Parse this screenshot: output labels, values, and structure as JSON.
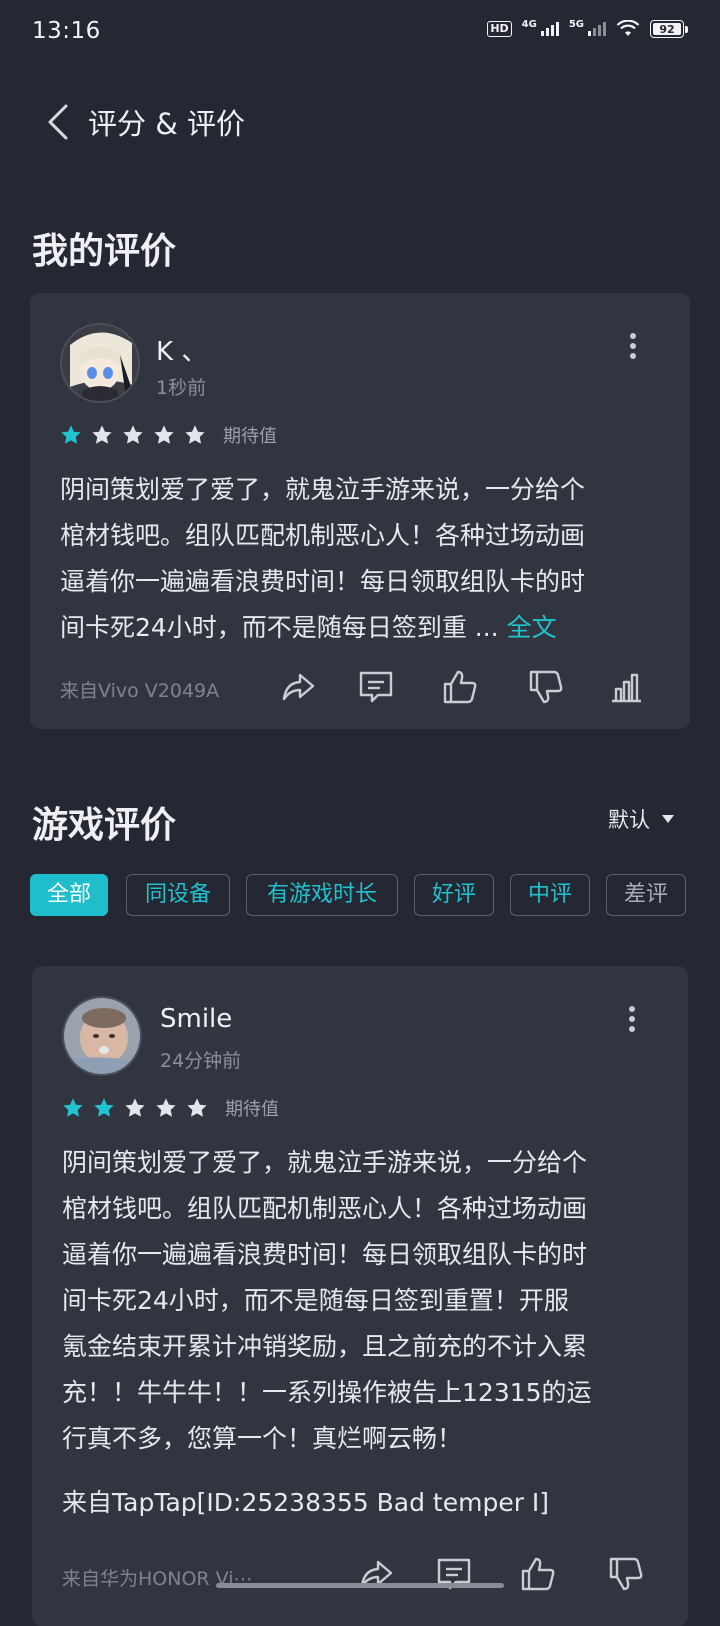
{
  "status_bar": {
    "time": "13:16",
    "hd": "HD",
    "net1": "4G",
    "net2": "5G",
    "battery": "92"
  },
  "header": {
    "title": "评分 & 评价"
  },
  "my_review": {
    "section_title": "我的评价",
    "username": "K 、",
    "time": "1秒前",
    "rating": 1,
    "rating_label": "期待值",
    "lines": [
      "阴间策划爱了爱了，就鬼泣手游来说，一分给个",
      "棺材钱吧。组队匹配机制恶心人！各种过场动画",
      "逼着你一遍遍看浪费时间！每日领取组队卡的时",
      "间卡死24小时，而不是随每日签到重 ..."
    ],
    "full_text_link": "全文",
    "device": "来自Vivo V2049A"
  },
  "game_reviews": {
    "section_title": "游戏评价",
    "sort_label": "默认",
    "filters": [
      "全部",
      "同设备",
      "有游戏时长",
      "好评",
      "中评",
      "差评"
    ],
    "active_filter": "全部",
    "review": {
      "username": "Smile",
      "time": "24分钟前",
      "rating": 2,
      "rating_label": "期待值",
      "lines": [
        "阴间策划爱了爱了，就鬼泣手游来说，一分给个",
        "棺材钱吧。组队匹配机制恶心人！各种过场动画",
        "逼着你一遍遍看浪费时间！每日领取组队卡的时",
        "间卡死24小时，而不是随每日签到重置！开服",
        "氪金结束开累计冲销奖励，且之前充的不计入累",
        "充！！牛牛牛！！一系列操作被告上12315的运",
        "行真不多，您算一个！真烂啊云畅！"
      ],
      "source_line": "来自TapTap[ID:25238355 Bad temper I]",
      "device": "来自华为HONOR Vi⋯"
    }
  },
  "colors": {
    "accent": "#1ebecd",
    "background": "#252832",
    "card": "#31353f"
  }
}
